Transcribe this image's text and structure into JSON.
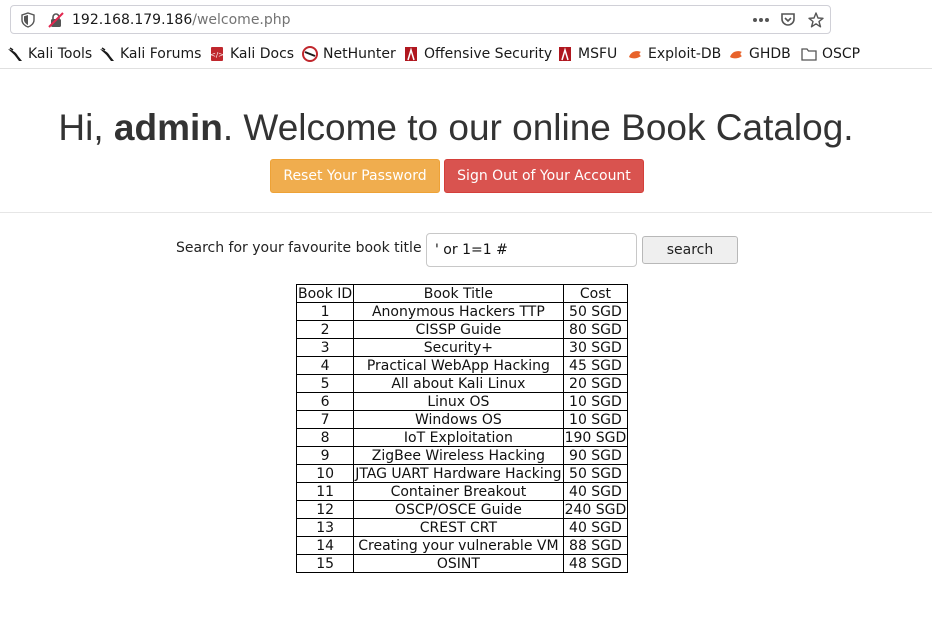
{
  "browser": {
    "url_host": "192.168.179.186",
    "url_path": "/welcome.php",
    "bookmarks": [
      {
        "label": "Kali Tools",
        "icon": "kali-dragon-icon"
      },
      {
        "label": "Kali Forums",
        "icon": "kali-dragon-icon"
      },
      {
        "label": "Kali Docs",
        "icon": "kali-docs-icon"
      },
      {
        "label": "NetHunter",
        "icon": "nethunter-icon"
      },
      {
        "label": "Offensive Security",
        "icon": "offsec-icon"
      },
      {
        "label": "MSFU",
        "icon": "msfu-icon"
      },
      {
        "label": "Exploit-DB",
        "icon": "exploit-db-icon"
      },
      {
        "label": "GHDB",
        "icon": "ghdb-icon"
      },
      {
        "label": "OSCP",
        "icon": "folder-icon"
      }
    ]
  },
  "page": {
    "greeting_prefix": "Hi, ",
    "username": "admin",
    "greeting_suffix": ". Welcome to our online Book Catalog.",
    "reset_button": "Reset Your Password",
    "signout_button": "Sign Out of Your Account",
    "search_label": "Search for your favourite book title",
    "search_value": "' or 1=1 #",
    "search_button": "search"
  },
  "table": {
    "headers": [
      "Book ID",
      "Book Title",
      "Cost"
    ],
    "rows": [
      [
        "1",
        "Anonymous Hackers TTP",
        "50 SGD"
      ],
      [
        "2",
        "CISSP Guide",
        "80 SGD"
      ],
      [
        "3",
        "Security+",
        "30 SGD"
      ],
      [
        "4",
        "Practical WebApp Hacking",
        "45 SGD"
      ],
      [
        "5",
        "All about Kali Linux",
        "20 SGD"
      ],
      [
        "6",
        "Linux OS",
        "10 SGD"
      ],
      [
        "7",
        "Windows OS",
        "10 SGD"
      ],
      [
        "8",
        "IoT Exploitation",
        "190 SGD"
      ],
      [
        "9",
        "ZigBee Wireless Hacking",
        "90 SGD"
      ],
      [
        "10",
        "JTAG UART Hardware Hacking",
        "50 SGD"
      ],
      [
        "11",
        "Container Breakout",
        "40 SGD"
      ],
      [
        "12",
        "OSCP/OSCE Guide",
        "240 SGD"
      ],
      [
        "13",
        "CREST CRT",
        "40 SGD"
      ],
      [
        "14",
        "Creating your vulnerable VM",
        "88 SGD"
      ],
      [
        "15",
        "OSINT",
        "48 SGD"
      ]
    ]
  },
  "colors": {
    "warning": "#f0ad4e",
    "danger": "#d9534f"
  }
}
